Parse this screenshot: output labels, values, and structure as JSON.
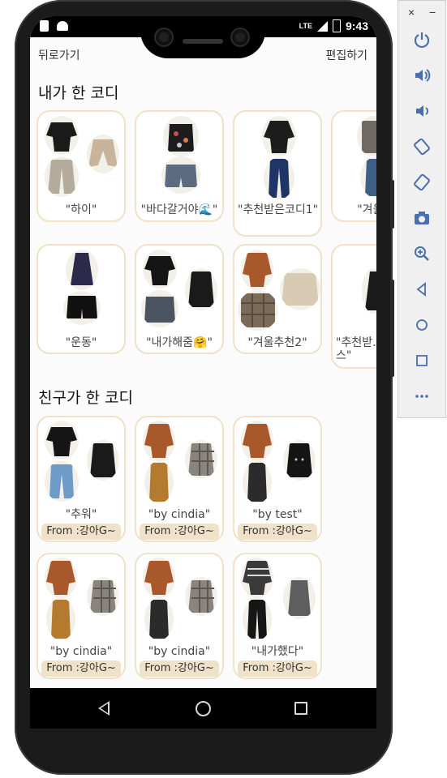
{
  "status": {
    "time": "9:43",
    "network": "LTE"
  },
  "topbar": {
    "back_label": "뒤로가기",
    "edit_label": "편집하기"
  },
  "sections": {
    "mine_title": "내가 한 코디",
    "friends_title": "친구가 한 코디"
  },
  "my_codis": [
    {
      "caption": "\"하이\""
    },
    {
      "caption": "\"바다갈거야🌊\""
    },
    {
      "caption": "\"추천받은코디1\""
    },
    {
      "caption": "\"겨울..."
    },
    {
      "caption": "\"운동\""
    },
    {
      "caption": "\"내가해줌🤗\""
    },
    {
      "caption": "\"겨울추천2\""
    },
    {
      "caption": "\"추천받... 원피스\""
    }
  ],
  "friend_codis": [
    {
      "caption": "\"추워\"",
      "from": "From :강아G~"
    },
    {
      "caption": "\"by cindia\"",
      "from": "From :강아G~"
    },
    {
      "caption": "\"by test\"",
      "from": "From :강아G~"
    },
    {
      "caption": "\"by cindia\"",
      "from": "From :강아G~"
    },
    {
      "caption": "\"by cindia\"",
      "from": "From :강아G~"
    },
    {
      "caption": "\"내가했다\"",
      "from": "From :강아G~"
    }
  ],
  "colors": {
    "card_border": "#efe2c8",
    "accent": "#efe2c8"
  }
}
